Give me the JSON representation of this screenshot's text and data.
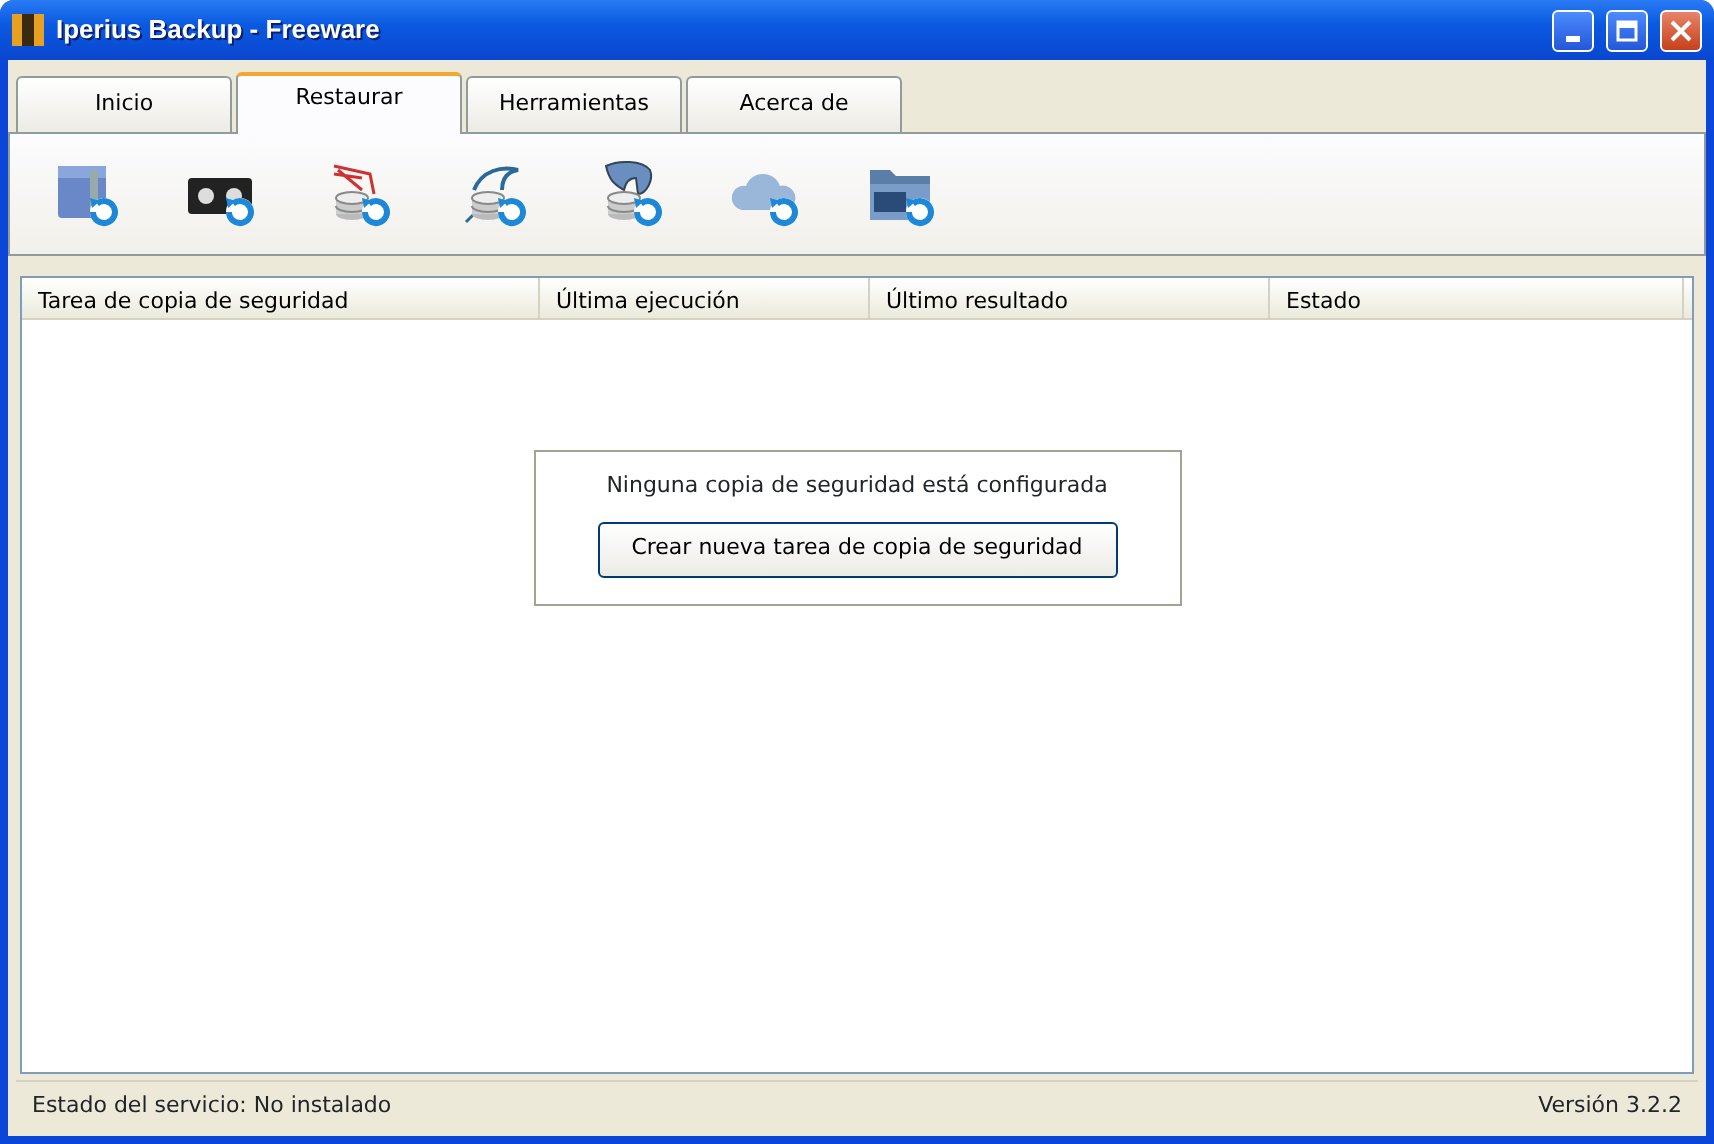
{
  "window": {
    "title": "Iperius Backup - Freeware"
  },
  "tabs": [
    {
      "label": "Inicio",
      "selected": false
    },
    {
      "label": "Restaurar",
      "selected": true
    },
    {
      "label": "Herramientas",
      "selected": false
    },
    {
      "label": "Acerca de",
      "selected": false
    }
  ],
  "toolbar": [
    {
      "kind": "archive"
    },
    {
      "kind": "tape"
    },
    {
      "kind": "database-net"
    },
    {
      "kind": "database-dolphin"
    },
    {
      "kind": "database-elephant"
    },
    {
      "kind": "cloud"
    },
    {
      "kind": "ftp"
    }
  ],
  "table": {
    "columns": [
      "Tarea de copia de seguridad",
      "Última ejecución",
      "Último resultado",
      "Estado"
    ]
  },
  "empty_state": {
    "message": "Ninguna copia de seguridad está configurada",
    "button": "Crear nueva tarea de copia de seguridad"
  },
  "status_bar": {
    "service": "Estado del servicio: No instalado",
    "version": "Versión 3.2.2"
  }
}
